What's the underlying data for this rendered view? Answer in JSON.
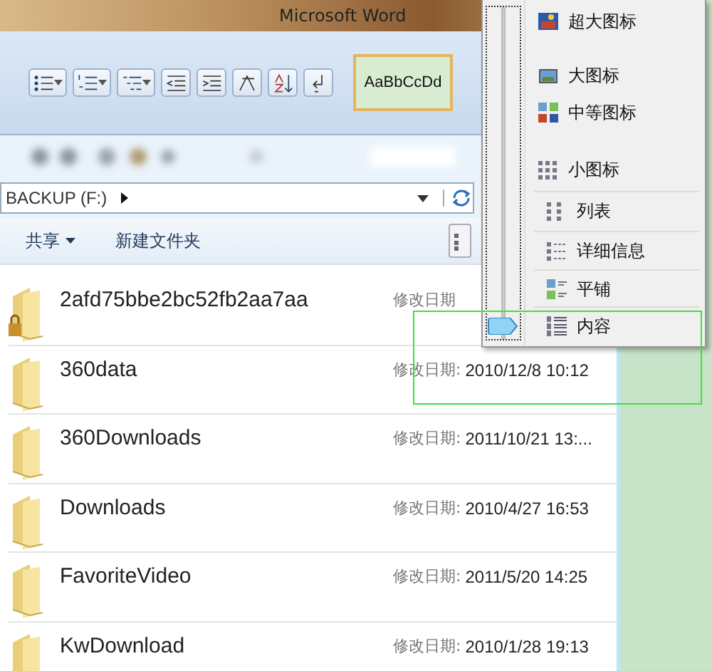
{
  "word_window": {
    "title": "Microsoft Word",
    "style_gallery": "AaBbCcDd"
  },
  "address_bar": {
    "path": "BACKUP (F:)"
  },
  "toolbar": {
    "buttons": [
      "共享",
      "新建文件夹"
    ]
  },
  "files": [
    {
      "name": "2afd75bbe2bc52fb2aa7aa",
      "locked": true,
      "date_label": "修改日期"
    },
    {
      "name": "360data",
      "locked": false,
      "date_label": "修改日期:",
      "date": "2010/12/8 10:12"
    },
    {
      "name": "360Downloads",
      "locked": false,
      "date_label": "修改日期:",
      "date": "2011/10/21 13:..."
    },
    {
      "name": "Downloads",
      "locked": false,
      "date_label": "修改日期:",
      "date": "2010/4/27 16:53"
    },
    {
      "name": "FavoriteVideo",
      "locked": false,
      "date_label": "修改日期:",
      "date": "2011/5/20 14:25"
    },
    {
      "name": "KwDownload",
      "locked": false,
      "date_label": "修改日期:",
      "date": "2010/1/28 19:13"
    }
  ],
  "view_menu": {
    "items": [
      {
        "label": "超大图标",
        "selected": false
      },
      {
        "label": "大图标",
        "selected": false
      },
      {
        "label": "中等图标",
        "selected": false
      },
      {
        "label": "小图标",
        "selected": false
      },
      {
        "label": "列表",
        "selected": false
      },
      {
        "label": "详细信息",
        "selected": false
      },
      {
        "label": "平铺",
        "selected": false
      },
      {
        "label": "内容",
        "selected": true
      }
    ]
  }
}
